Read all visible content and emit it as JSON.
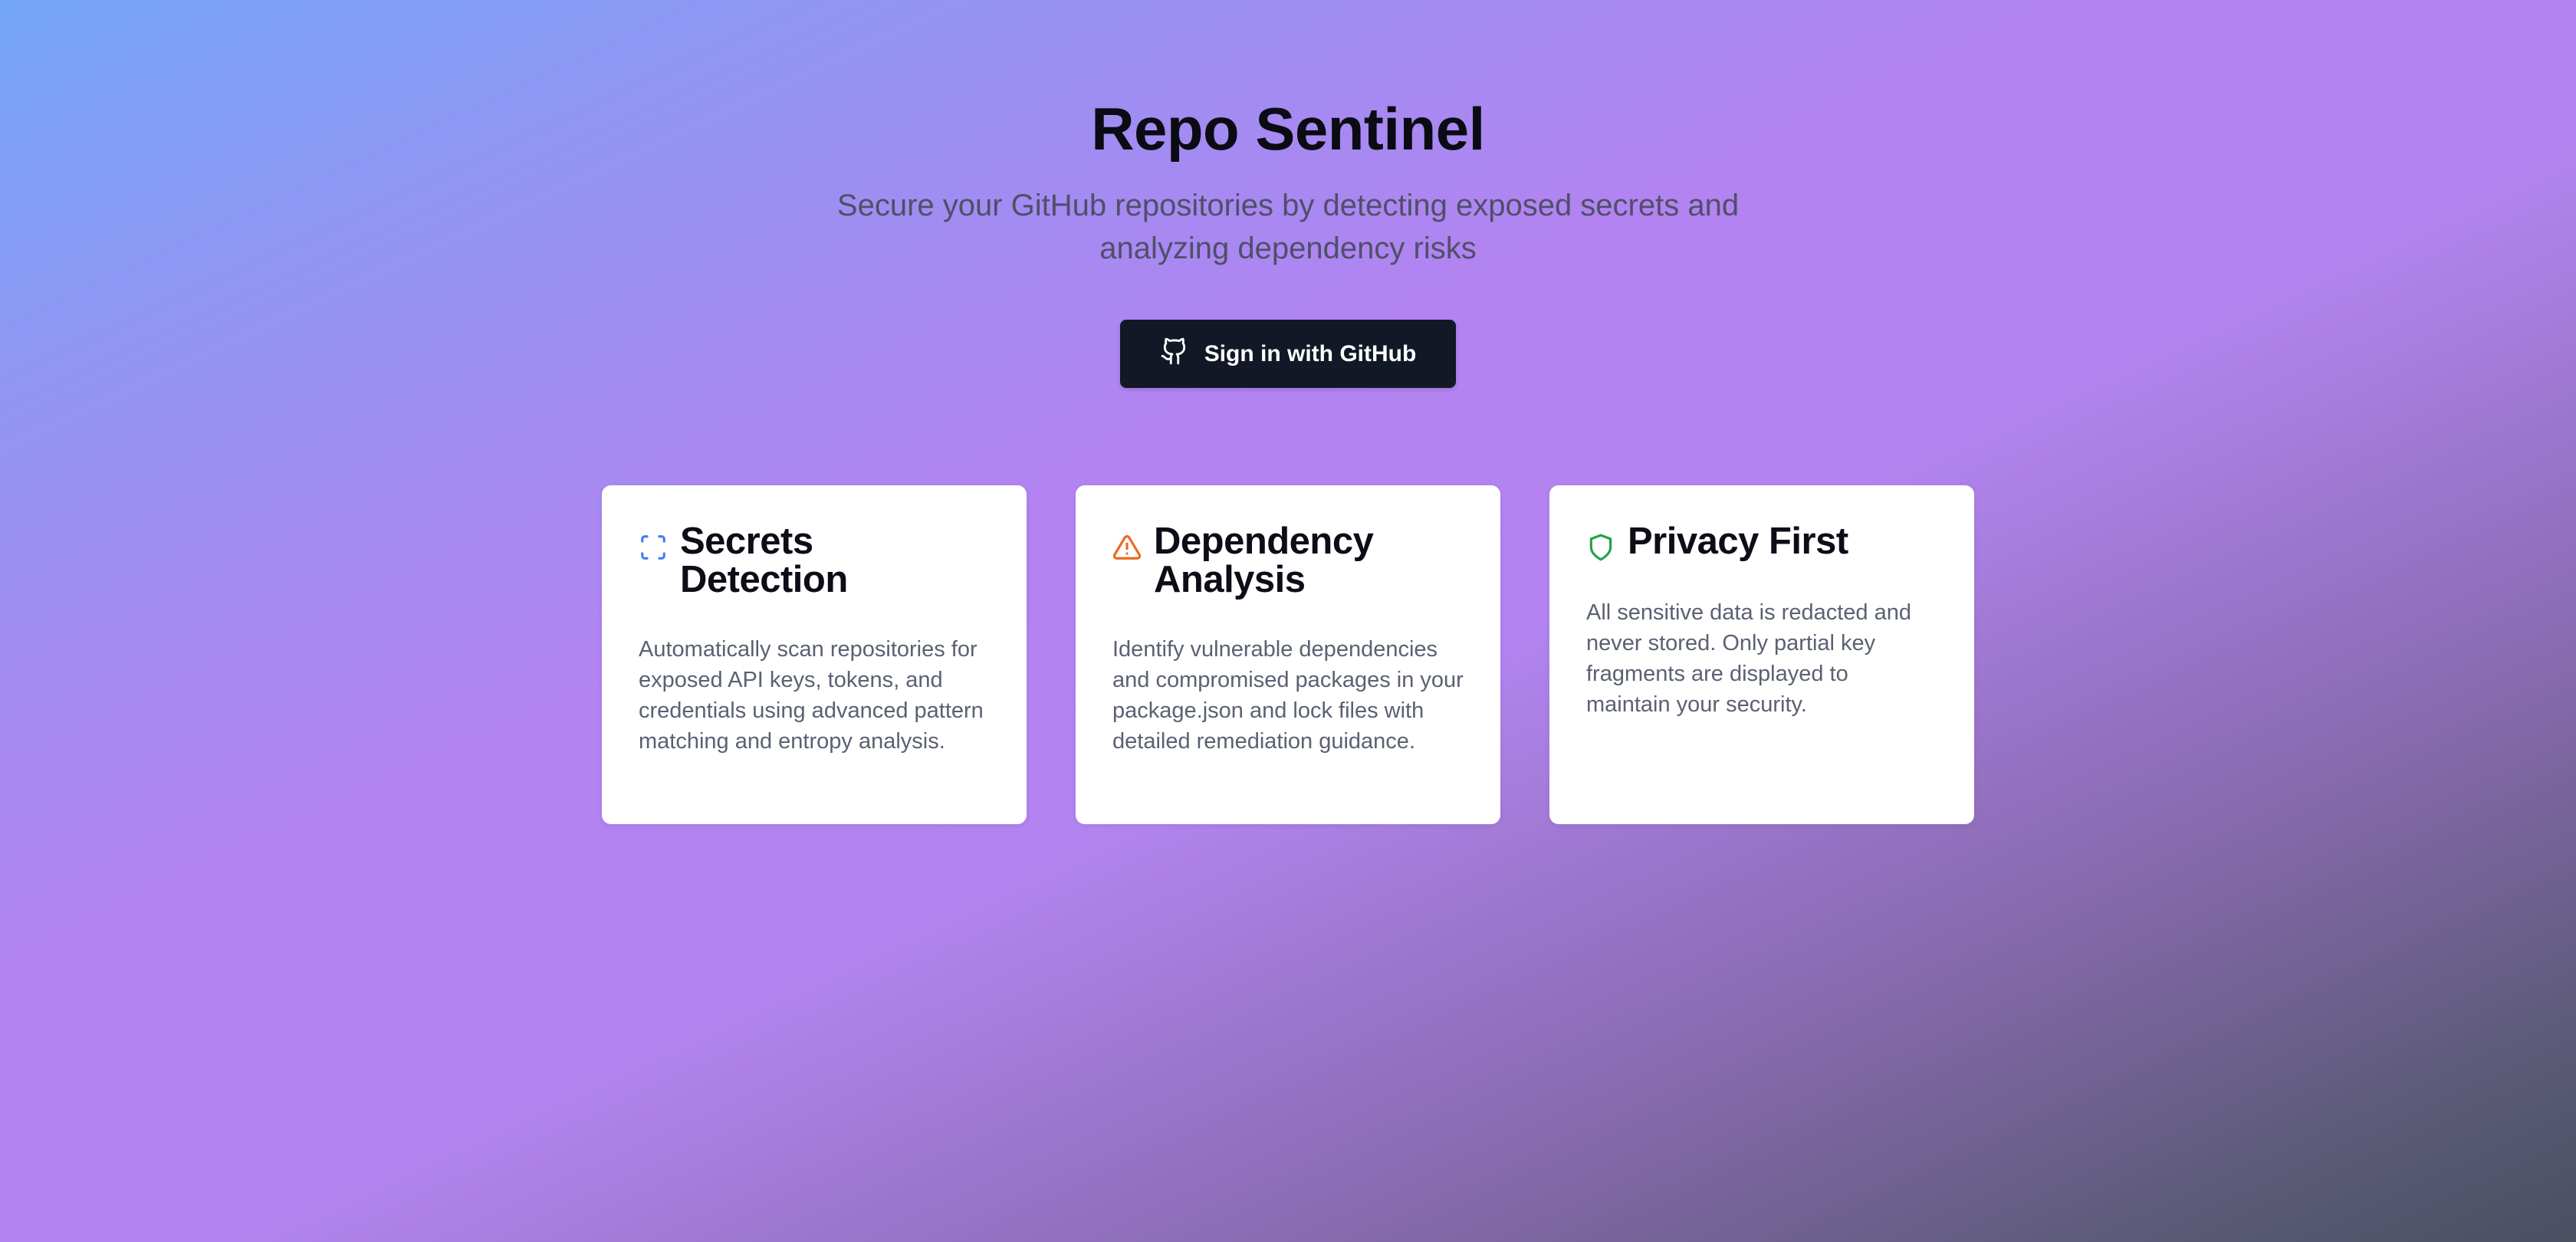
{
  "header": {
    "title": "Repo Sentinel",
    "subtitle": "Secure your GitHub repositories by detecting exposed secrets and analyzing dependency risks"
  },
  "signin": {
    "label": "Sign in with GitHub",
    "icon": "github-icon"
  },
  "features": [
    {
      "icon": "scan-icon",
      "icon_color": "#3b82f6",
      "title": "Secrets Detection",
      "description": "Automatically scan repositories for exposed API keys, tokens, and credentials using advanced pattern matching and entropy analysis."
    },
    {
      "icon": "warning-triangle-icon",
      "icon_color": "#ea6a1f",
      "title": "Dependency Analysis",
      "description": "Identify vulnerable dependencies and compromised packages in your package.json and lock files with detailed remediation guidance."
    },
    {
      "icon": "shield-icon",
      "icon_color": "#22a34a",
      "title": "Privacy First",
      "description": "All sensitive data is redacted and never stored. Only partial key fragments are displayed to maintain your security."
    }
  ],
  "colors": {
    "button_bg": "#121826",
    "card_bg": "#ffffff",
    "gradient_start": "#74a6f6",
    "gradient_mid": "#b383f1",
    "gradient_end": "#4a4f62"
  }
}
